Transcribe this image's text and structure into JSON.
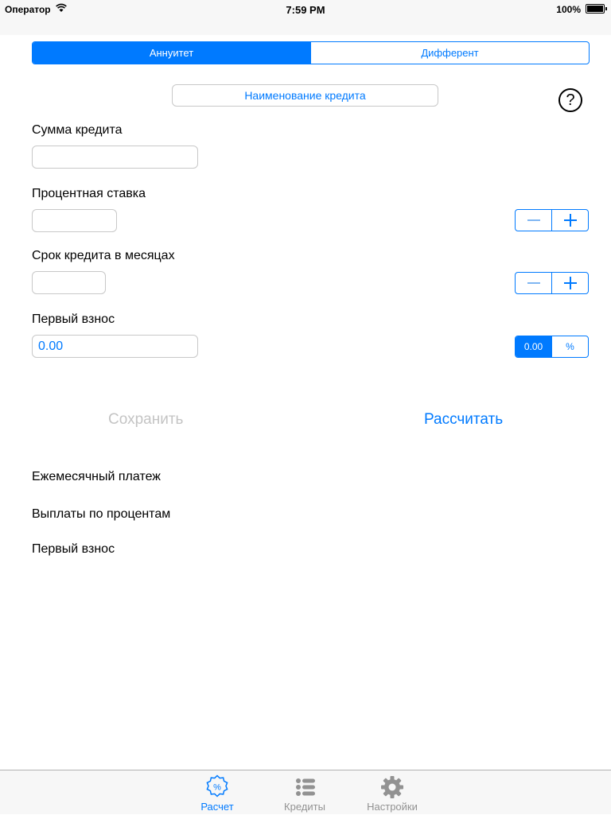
{
  "status_bar": {
    "carrier": "Оператор",
    "time": "7:59 PM",
    "battery": "100%"
  },
  "segment": {
    "items": [
      "Аннуитет",
      "Дифферент"
    ],
    "selected": "Аннуитет"
  },
  "loan_name_button": "Наименование кредита",
  "help_button": "?",
  "form": {
    "amount": {
      "label": "Сумма кредита",
      "value": ""
    },
    "rate": {
      "label": "Процентная ставка",
      "value": ""
    },
    "term": {
      "label": "Срок кредита в месяцах",
      "value": ""
    },
    "down_payment": {
      "label": "Первый взнос",
      "value": "0.00"
    },
    "down_payment_mode": {
      "options": [
        "0.00",
        "%"
      ],
      "selected": "0.00"
    }
  },
  "actions": {
    "save": "Сохранить",
    "calculate": "Рассчитать"
  },
  "results": {
    "monthly_payment": "Ежемесячный платеж",
    "interest_payments": "Выплаты по процентам",
    "down_payment": "Первый взнос"
  },
  "tabbar": {
    "tabs": [
      {
        "label": "Расчет",
        "icon": "percent-badge-icon",
        "active": true
      },
      {
        "label": "Кредиты",
        "icon": "list-icon",
        "active": false
      },
      {
        "label": "Настройки",
        "icon": "gear-icon",
        "active": false
      }
    ]
  },
  "colors": {
    "accent": "#007aff",
    "disabled": "#c4c4c4",
    "tab_inactive": "#929292"
  }
}
